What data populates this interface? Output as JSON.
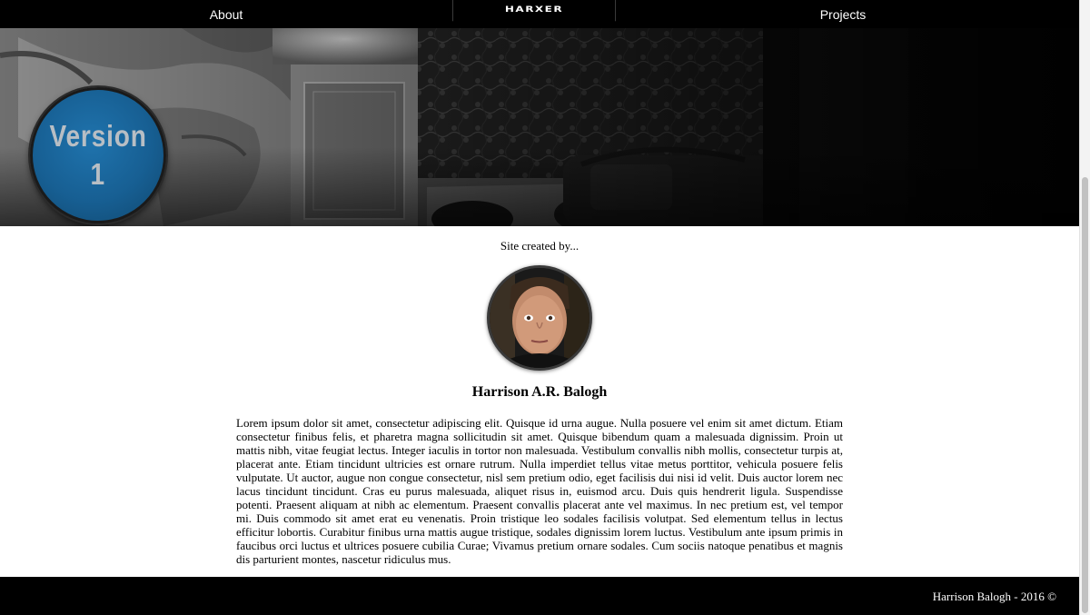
{
  "nav": {
    "about_label": "About",
    "logo_text": "HARXER",
    "projects_label": "Projects"
  },
  "hero": {
    "badge_line1": "Version",
    "badge_line2": "1",
    "badge_color": "#1a6aa3"
  },
  "main": {
    "credit_text": "Site created by...",
    "author_name": "Harrison A.R. Balogh",
    "bio_text": "Lorem ipsum dolor sit amet, consectetur adipiscing elit. Quisque id urna augue. Nulla posuere vel enim sit amet dictum. Etiam consectetur finibus felis, et pharetra magna sollicitudin sit amet. Quisque bibendum quam a malesuada dignissim. Proin ut mattis nibh, vitae feugiat lectus. Integer iaculis in tortor non malesuada. Vestibulum convallis nibh mollis, consectetur turpis at, placerat ante. Etiam tincidunt ultricies est ornare rutrum. Nulla imperdiet tellus vitae metus porttitor, vehicula posuere felis vulputate. Ut auctor, augue non congue consectetur, nisl sem pretium odio, eget facilisis dui nisi id velit. Duis auctor lorem nec lacus tincidunt tincidunt. Cras eu purus malesuada, aliquet risus in, euismod arcu. Duis quis hendrerit ligula. Suspendisse potenti. Praesent aliquam at nibh ac elementum. Praesent convallis placerat ante vel maximus. In nec pretium est, vel tempor mi. Duis commodo sit amet erat eu venenatis. Proin tristique leo sodales facilisis volutpat. Sed elementum tellus in lectus efficitur lobortis. Curabitur finibus urna mattis augue tristique, sodales dignissim lorem luctus. Vestibulum ante ipsum primis in faucibus orci luctus et ultrices posuere cubilia Curae; Vivamus pretium ornare sodales. Cum sociis natoque penatibus et magnis dis parturient montes, nascetur ridiculus mus."
  },
  "footer": {
    "text": "Harrison Balogh - 2016 ©"
  },
  "colors": {
    "nav_bg": "#000000",
    "footer_bg": "#000000",
    "page_bg": "#ffffff",
    "badge_blue": "#1a6aa3"
  }
}
